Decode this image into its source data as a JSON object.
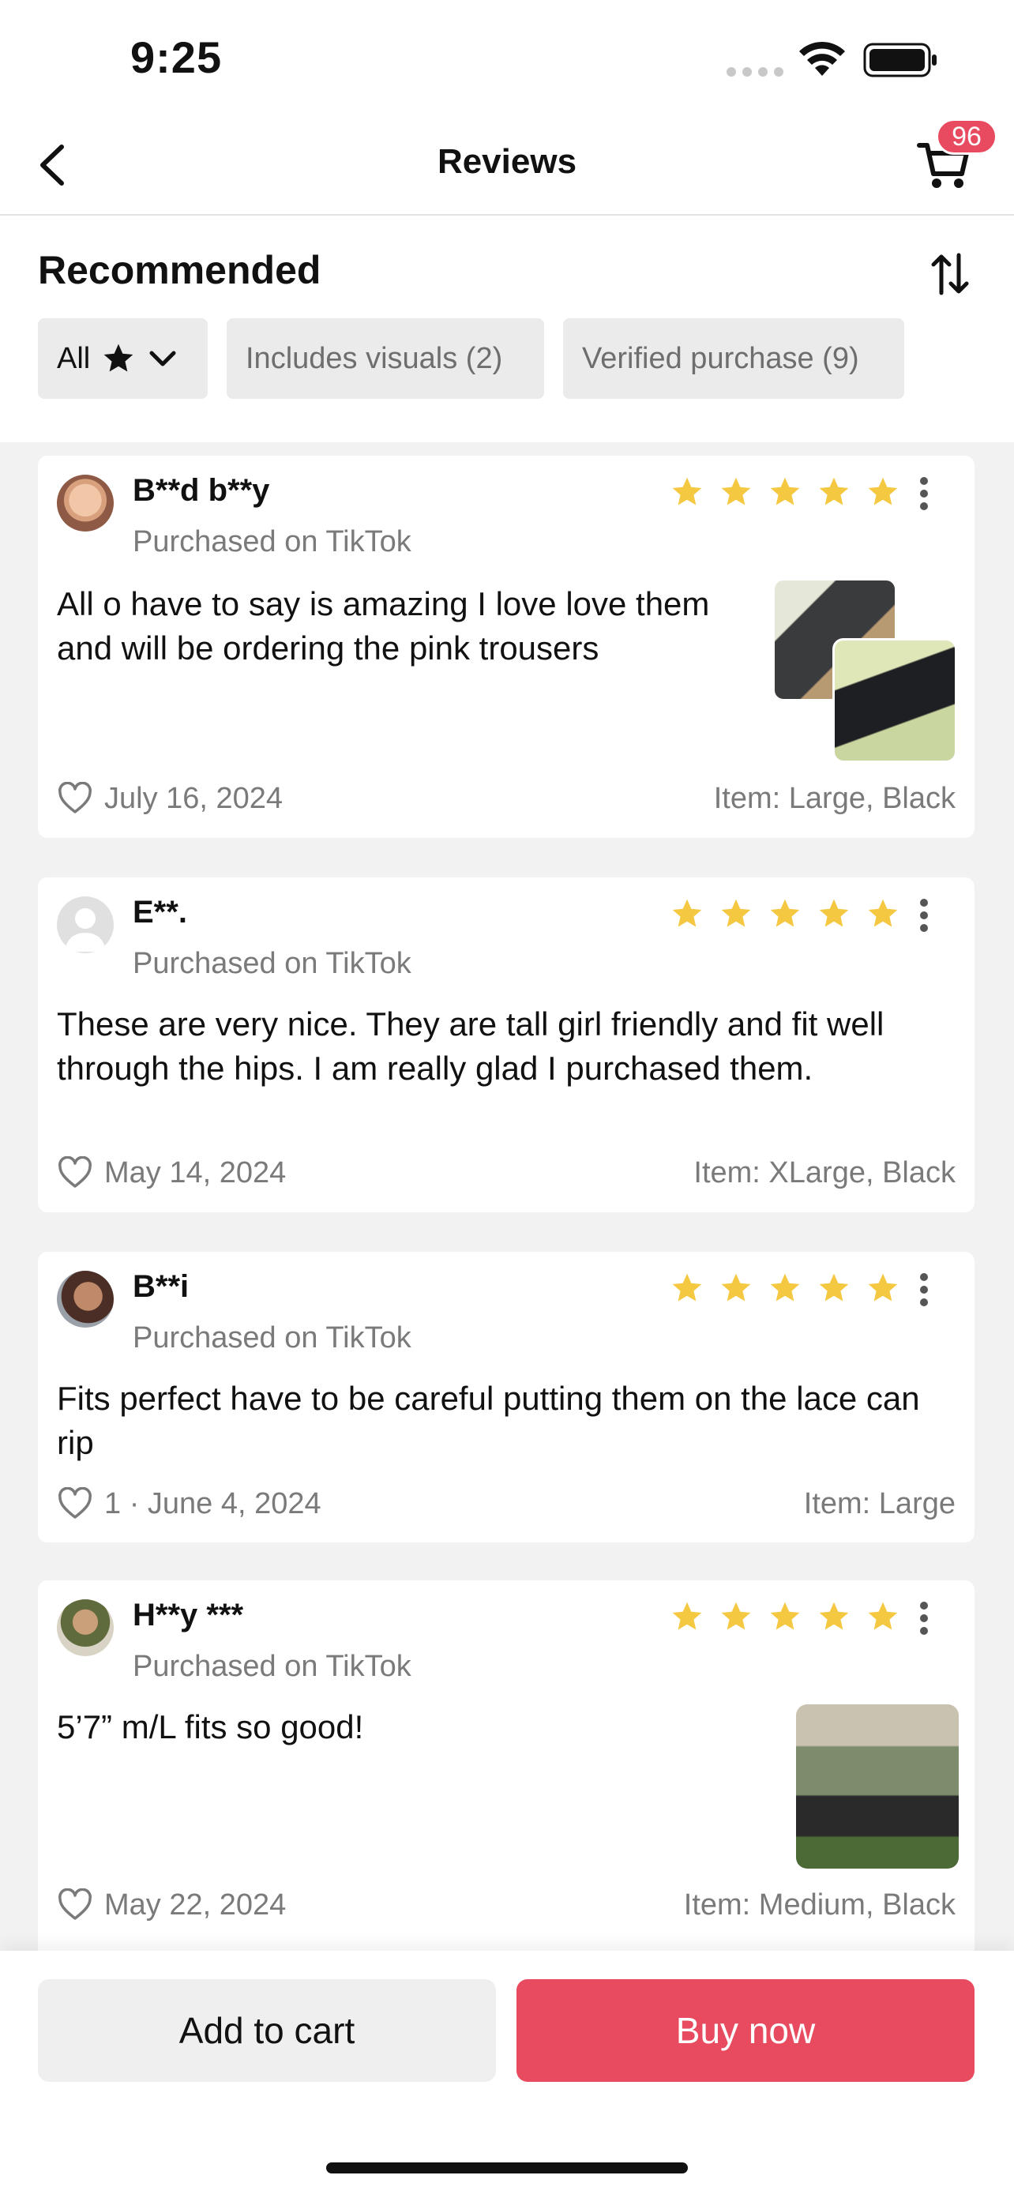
{
  "status_bar": {
    "time": "9:25"
  },
  "header": {
    "title": "Reviews",
    "cart_count": "96"
  },
  "controls": {
    "section_title": "Recommended",
    "filters": [
      {
        "label": "All"
      },
      {
        "label": "Includes visuals (2)"
      },
      {
        "label": "Verified purchase (9)"
      }
    ]
  },
  "reviews": [
    {
      "name": "B**d b**y",
      "source": "Purchased on TikTok",
      "rating": 5,
      "text": "All o have to say is amazing I love love them and will be ordering the pink trousers",
      "date": "July 16, 2024",
      "item": "Item: Large, Black"
    },
    {
      "name": "E**.",
      "source": "Purchased on TikTok",
      "rating": 5,
      "text": "These are very nice. They are tall girl friendly and fit well through the hips.  I am really glad I purchased them.",
      "date": "May 14, 2024",
      "item": "Item: XLarge, Black"
    },
    {
      "name": "B**i",
      "source": "Purchased on TikTok",
      "rating": 5,
      "text": "Fits perfect have to be careful putting them on the lace can rip",
      "date": "1 · June 4, 2024",
      "item": "Item: Large"
    },
    {
      "name": "H**y ***",
      "source": "Purchased on TikTok",
      "rating": 5,
      "text": "5’7” m/L fits so good!",
      "date": "May 22, 2024",
      "item": "Item: Medium, Black"
    }
  ],
  "actions": {
    "add_to_cart": "Add to cart",
    "buy_now": "Buy now"
  },
  "colors": {
    "accent": "#e84a5f",
    "star": "#f5c842",
    "chip_bg": "#ebebeb"
  }
}
